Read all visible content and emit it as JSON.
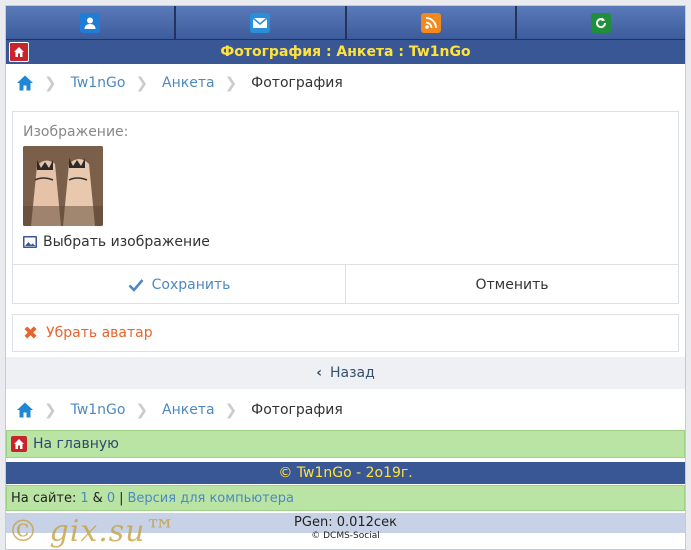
{
  "top_nav": [
    {
      "name": "profile-icon",
      "color": "#1e7dd7"
    },
    {
      "name": "mail-icon",
      "color": "#2a8fd8"
    },
    {
      "name": "rss-icon",
      "color": "#f08a1e"
    },
    {
      "name": "refresh-icon",
      "color": "#1f8f3a"
    }
  ],
  "title": "Фотография : Анкета : Tw1nGo",
  "breadcrumb": {
    "items": [
      "Tw1nGo",
      "Анкета"
    ],
    "current": "Фотография"
  },
  "form": {
    "image_label": "Изображение:",
    "choose_label": "Выбрать изображение",
    "save_label": "Сохранить",
    "cancel_label": "Отменить"
  },
  "remove_avatar": "Убрать аватар",
  "back_label": "Назад",
  "main_link": "На главную",
  "copyright": "© Tw1nGo - 2o19г.",
  "online": {
    "prefix": "На сайте:",
    "count1": "1",
    "amp": "&",
    "count2": "0",
    "divider": "|",
    "desktop": "Версия для компьютера"
  },
  "pgen": "PGen: 0.012сек",
  "dcms": "© DCMS-Social",
  "watermark": "© gix.su™",
  "colors": {
    "brand": "#3a5795",
    "title_text": "#ffe33b",
    "link": "#4d89bf",
    "green": "#b9e4a4",
    "remove": "#e8642c"
  }
}
